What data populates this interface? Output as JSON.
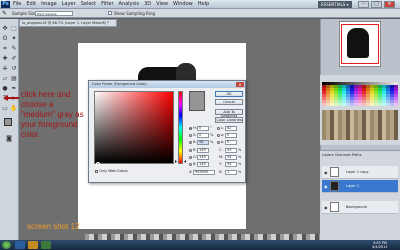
{
  "app": {
    "logo": "Ps",
    "menus": [
      "File",
      "Edit",
      "Image",
      "Layer",
      "Select",
      "Filter",
      "Analysis",
      "3D",
      "View",
      "Window",
      "Help"
    ],
    "workspace": "ESSENTIALS ▾",
    "window_buttons": [
      "–",
      "□",
      "✕"
    ]
  },
  "options_bar": {
    "tool_icon": "eyedropper-icon",
    "sample_label": "Sample Size:",
    "sample_value": "Point Sample",
    "show_ring_label": "Show Sampling Ring"
  },
  "document": {
    "tab_title": "lo_progress.tif @ 66.7% (Layer 1, Layer Mask/8) *",
    "annotation": "click here and choose a \"medium\" gray as your foreground color.",
    "caption": "screen shot 12"
  },
  "color_picker": {
    "title": "Color Picker (Foreground Color)",
    "close": "✕",
    "buttons": {
      "ok": "OK",
      "cancel": "Cancel",
      "add_swatches": "Add To Swatches",
      "color_libraries": "Color Libraries"
    },
    "current_color": "#959595",
    "fields": {
      "H": {
        "label": "H:",
        "value": "0",
        "unit": "°"
      },
      "S": {
        "label": "S:",
        "value": "0",
        "unit": "%"
      },
      "B": {
        "label": "B:",
        "value": "58",
        "unit": "%"
      },
      "R": {
        "label": "R:",
        "value": "149"
      },
      "G": {
        "label": "G:",
        "value": "149"
      },
      "Bl": {
        "label": "B:",
        "value": "149"
      },
      "L": {
        "label": "L:",
        "value": "62"
      },
      "a": {
        "label": "a:",
        "value": "0"
      },
      "b": {
        "label": "b:",
        "value": "0"
      },
      "C": {
        "label": "C:",
        "value": "43",
        "unit": "%"
      },
      "M": {
        "label": "M:",
        "value": "34",
        "unit": "%"
      },
      "Y": {
        "label": "Y:",
        "value": "34",
        "unit": "%"
      },
      "K": {
        "label": "K:",
        "value": "1",
        "unit": "%"
      },
      "hex": {
        "label": "#",
        "value": "959595"
      }
    },
    "only_web_colors": "Only Web Colors"
  },
  "layers": {
    "tabs": [
      "Layers",
      "Channels",
      "Paths"
    ],
    "rows": [
      {
        "name": "Layer 1 copy"
      },
      {
        "name": "Layer 1"
      },
      {
        "name": "Background"
      }
    ]
  },
  "taskbar": {
    "time": "3:05 PM",
    "date": "4/4/2011"
  }
}
